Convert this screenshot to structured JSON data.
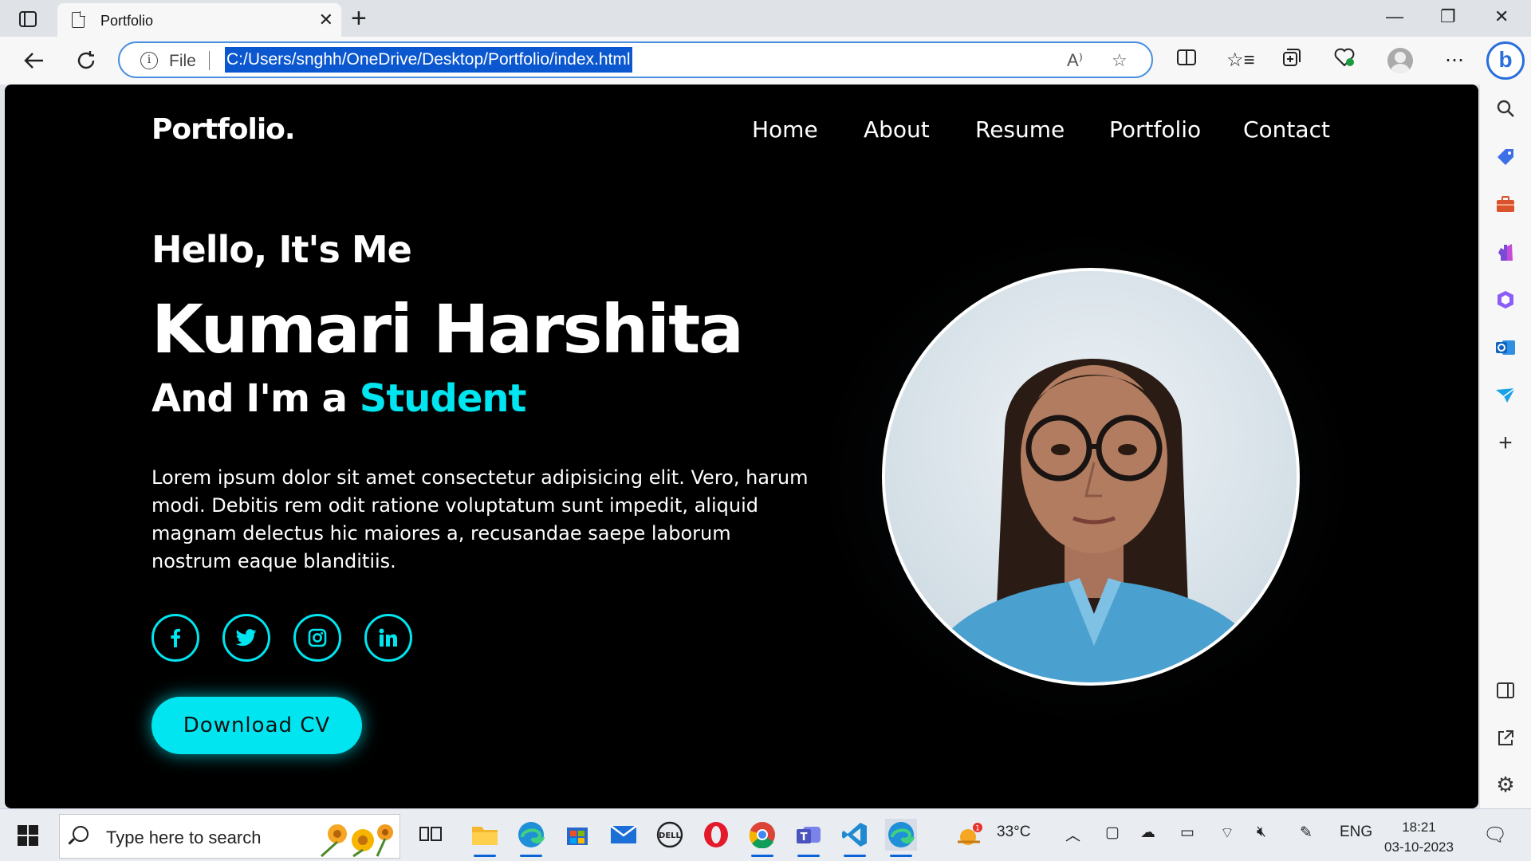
{
  "browser": {
    "tab_title": "Portfolio",
    "address": {
      "scheme_label": "File",
      "url": "C:/Users/snghh/OneDrive/Desktop/Portfolio/index.html"
    }
  },
  "site": {
    "logo": "Portfolio.",
    "nav": [
      "Home",
      "About",
      "Resume",
      "Portfolio",
      "Contact"
    ],
    "greeting": "Hello, It's Me",
    "name": "Kumari Harshita",
    "role_prefix": "And I'm a ",
    "role": "Student",
    "description": "Lorem ipsum dolor sit amet consectetur adipisicing elit. Vero, harum modi. Debitis rem odit ratione voluptatum sunt impedit, aliquid magnam delectus hic maiores a, recusandae saepe laborum nostrum eaque blanditiis.",
    "socials": [
      "facebook-icon",
      "twitter-icon",
      "instagram-icon",
      "linkedin-icon"
    ],
    "cta": "Download CV",
    "accent": "#00e5ef"
  },
  "taskbar": {
    "search_placeholder": "Type here to search",
    "weather": "33°C",
    "weather_badge": "1",
    "language": "ENG",
    "time": "18:21",
    "date": "03-10-2023"
  }
}
